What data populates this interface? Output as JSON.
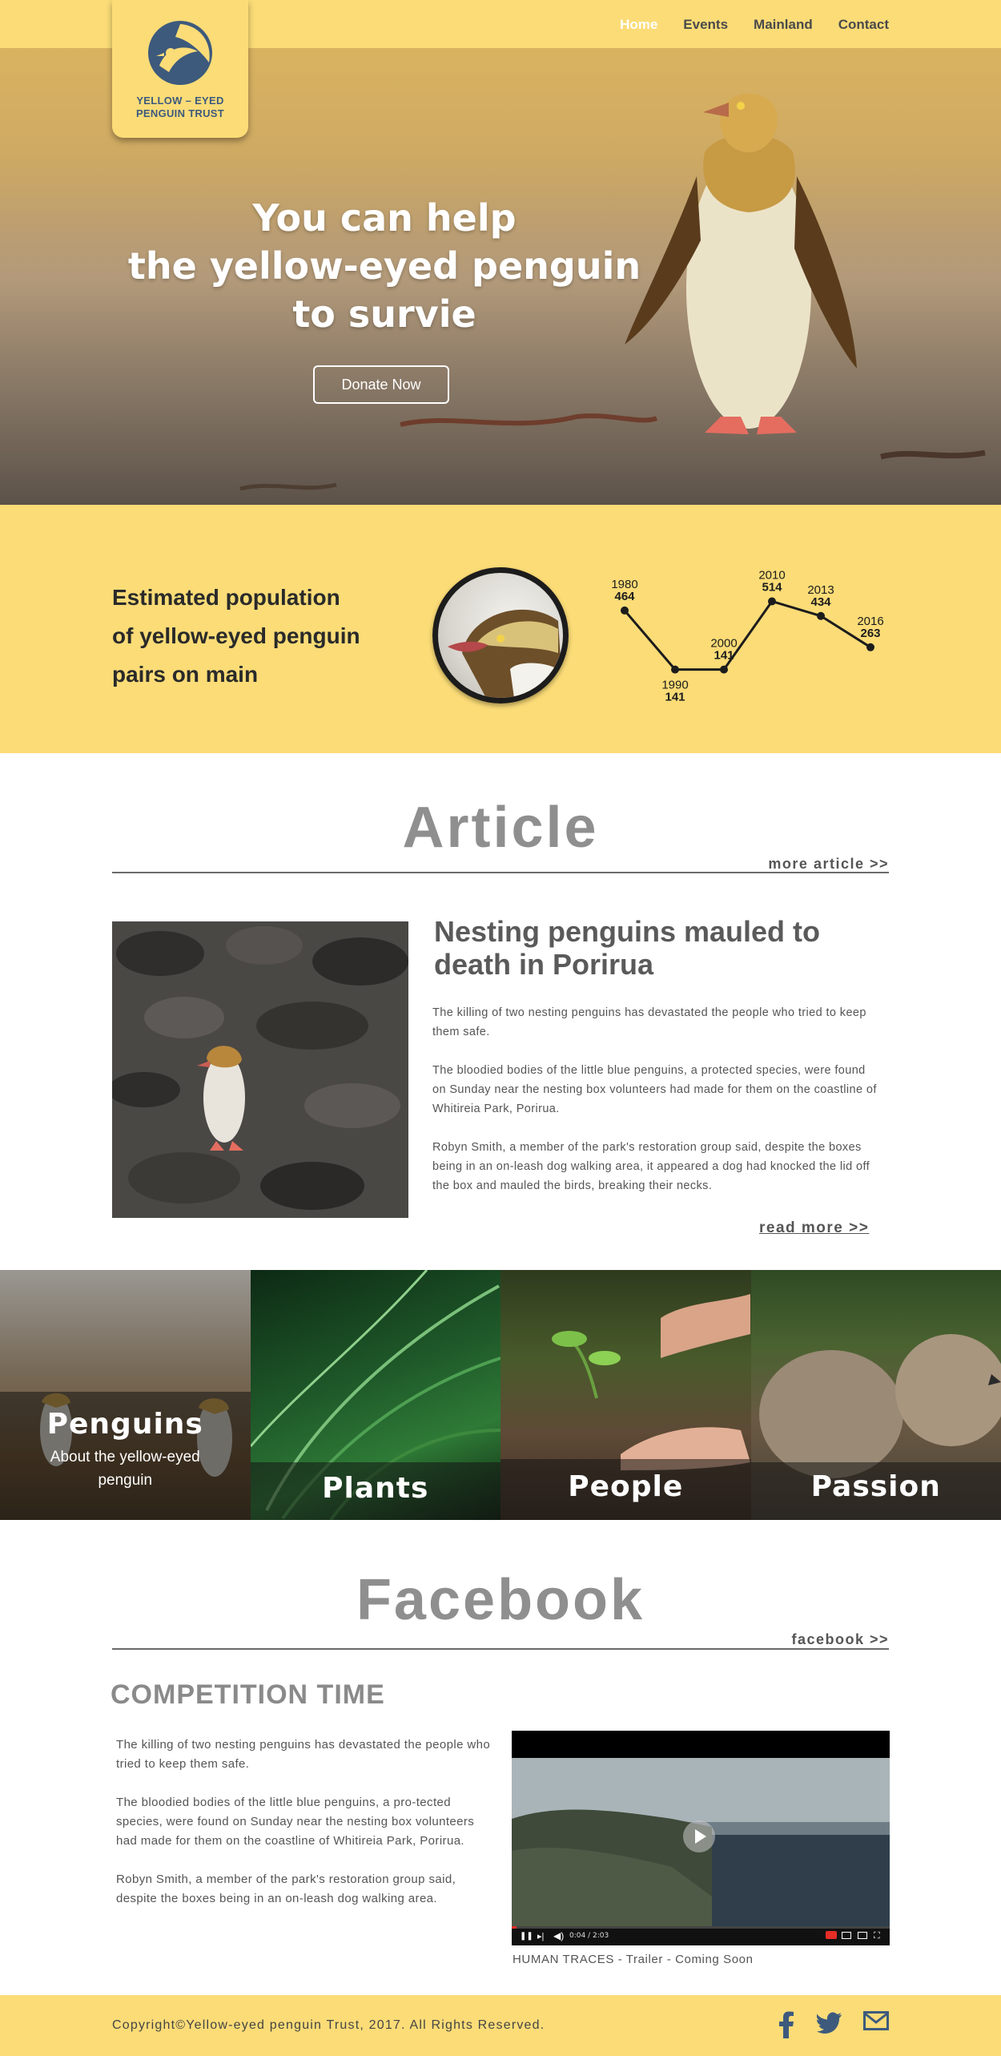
{
  "brand": {
    "logo_line1": "YELLOW – EYED",
    "logo_line2": "PENGUIN TRUST",
    "accent_color": "#fbdc77"
  },
  "nav": {
    "items": [
      {
        "label": "Home"
      },
      {
        "label": "Events"
      },
      {
        "label": "Mainland"
      },
      {
        "label": "Contact"
      }
    ],
    "active": "Home"
  },
  "hero": {
    "title_line1": "You can help",
    "title_line2": "the yellow-eyed penguin",
    "title_line3": "to survie",
    "donate_label": "Donate Now"
  },
  "population": {
    "heading_line1": "Estimated population",
    "heading_line2": "of yellow-eyed penguin",
    "heading_line3": "pairs on main"
  },
  "chart_data": {
    "type": "line",
    "x": [
      "1980",
      "1990",
      "2000",
      "2010",
      "2013",
      "2016"
    ],
    "series": [
      {
        "values": [
          464,
          141,
          141,
          514,
          434,
          263
        ]
      }
    ],
    "xlabel": "",
    "ylabel": "",
    "grid": false
  },
  "article_section": {
    "title": "Article",
    "more_label": "more article >>",
    "headline": "Nesting penguins mauled to death in Porirua",
    "paragraphs": [
      "The killing of two nesting penguins has devastated the people who tried to keep them safe.",
      "The bloodied bodies of the little blue penguins, a protected species, were found on Sunday near the nesting box volunteers had made for them on the coastline of Whitireia Park, Porirua.",
      "Robyn Smith, a member of the park's restoration group said, despite the boxes being in an on-leash dog walking area, it appeared a dog had knocked the lid off the box and mauled the birds, breaking their necks."
    ],
    "read_more_label": "read more >>"
  },
  "tiles": [
    {
      "title": "Penguins",
      "subtitle_line1": "About the yellow-eyed",
      "subtitle_line2": "penguin"
    },
    {
      "title": "Plants"
    },
    {
      "title": "People"
    },
    {
      "title": "Passion"
    }
  ],
  "facebook_section": {
    "title": "Facebook",
    "more_label": "facebook >>",
    "competition_title": "COMPETITION TIME",
    "paragraphs": [
      "The killing of two nesting penguins has devastated the people who tried to keep them safe.",
      "The bloodied bodies of the little blue penguins, a pro-tected species, were found on Sunday near the nesting box volunteers had made for them on the coastline of Whitireia Park, Porirua.",
      "Robyn Smith, a member of the park's restoration group said, despite the boxes being in an on-leash dog walking area."
    ],
    "video_time": "0:04 / 2:03",
    "video_caption": "HUMAN TRACES - Trailer - Coming Soon"
  },
  "footer": {
    "copyright": "Copyright©Yellow-eyed penguin Trust, 2017. All Rights Reserved.",
    "social_icons": [
      "facebook-icon",
      "twitter-icon",
      "mail-icon"
    ]
  }
}
